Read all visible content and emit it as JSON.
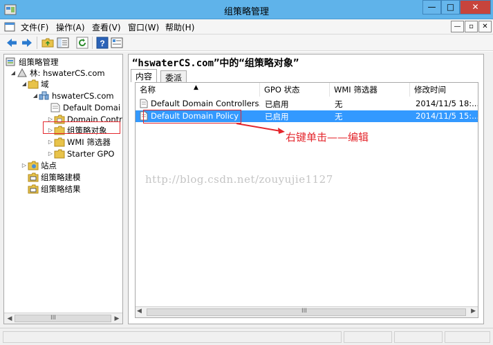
{
  "window": {
    "title": "组策略管理"
  },
  "window_controls": {
    "minimize": "—",
    "maximize": "□",
    "close": "✕"
  },
  "menu": {
    "items": [
      {
        "label": "文件(F)"
      },
      {
        "label": "操作(A)"
      },
      {
        "label": "查看(V)"
      },
      {
        "label": "窗口(W)"
      },
      {
        "label": "帮助(H)"
      }
    ],
    "mdi": {
      "minimize": "—",
      "restore": "▫",
      "close": "✕"
    }
  },
  "toolbar": {
    "icons": [
      "back-arrow-icon",
      "forward-arrow-icon",
      "up-folder-icon",
      "show-tree-icon",
      "refresh-icon",
      "help-icon",
      "properties-icon"
    ]
  },
  "tree": {
    "items": [
      {
        "label": "组策略管理"
      },
      {
        "label": "林: hswaterCS.com",
        "expander": "◢"
      },
      {
        "label": "域",
        "expander": "◢"
      },
      {
        "label": "hswaterCS.com",
        "expander": "◢"
      },
      {
        "label": "Default Domai"
      },
      {
        "label": "Domain Contro",
        "expander": "▷"
      },
      {
        "label": "组策略对象",
        "expander": "▷"
      },
      {
        "label": "WMI 筛选器",
        "expander": "▷"
      },
      {
        "label": "Starter GPO",
        "expander": "▷"
      },
      {
        "label": "站点",
        "expander": "▷"
      },
      {
        "label": "组策略建模"
      },
      {
        "label": "组策略结果"
      }
    ],
    "scroll_left": "◀",
    "scroll_right": "▶",
    "scroll_grip": "III"
  },
  "right_pane": {
    "title": "“hswaterCS.com”中的“组策略对象”",
    "tabs": [
      {
        "label": "内容",
        "active": true
      },
      {
        "label": "委派",
        "active": false
      }
    ],
    "columns": [
      "名称",
      "GPO 状态",
      "WMI 筛选器",
      "修改时间"
    ],
    "sort_indicator": "▲",
    "rows": [
      {
        "name": "Default Domain Controllers...",
        "status": "已启用",
        "wmi": "无",
        "modified": "2014/11/5 18:...",
        "selected": false
      },
      {
        "name": "Default Domain Policy",
        "status": "已启用",
        "wmi": "无",
        "modified": "2014/11/5 15:...",
        "selected": true
      }
    ],
    "scroll_left": "◀",
    "scroll_right": "▶",
    "scroll_grip": "III"
  },
  "annotation": {
    "text": "右键单击——编辑",
    "color": "#e4262c"
  },
  "watermark": {
    "text": "http://blog.csdn.net/zouyujie1127"
  },
  "colors": {
    "titlebar": "#5fb3ea",
    "selection": "#3399ff",
    "close_button": "#c7443c",
    "annotation": "#e4262c"
  }
}
